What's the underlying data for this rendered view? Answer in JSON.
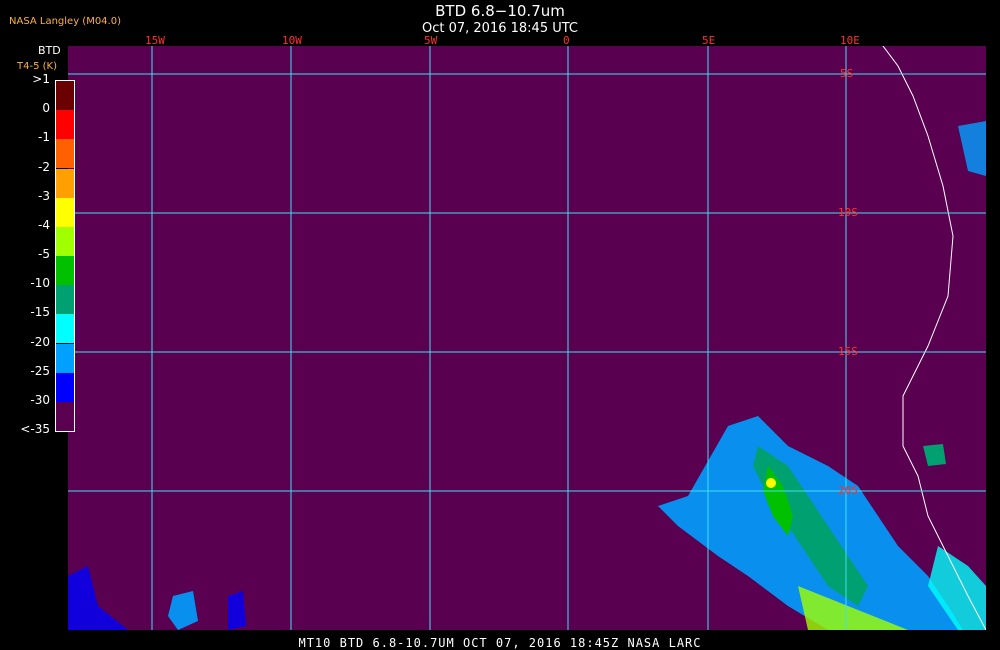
{
  "header": {
    "title": "BTD 6.8−10.7um",
    "subtitle": "Oct 07, 2016 18:45 UTC",
    "credit": "NASA Langley (M04.0)"
  },
  "legend": {
    "title": "BTD",
    "subtitle": "T4-5 (K)",
    "levels": [
      ">1",
      "0",
      "-1",
      "-2",
      "-3",
      "-4",
      "-5",
      "-10",
      "-15",
      "-20",
      "-25",
      "-30",
      "<-35"
    ],
    "colors": [
      "#6b0000",
      "#ff0000",
      "#ff6000",
      "#ffa000",
      "#ffff00",
      "#a0ff00",
      "#00c000",
      "#00a070",
      "#00ffff",
      "#00a0ff",
      "#0000ff",
      "#5a0050"
    ]
  },
  "map": {
    "background_color": "#5a0050",
    "grid_color": "#40e0f0",
    "coast_color": "#ffffff",
    "longitude_labels": [
      "15W",
      "10W",
      "5W",
      "0",
      "5E",
      "10E"
    ],
    "latitude_labels": [
      "5S",
      "10S",
      "15S",
      "20S"
    ]
  },
  "footer": {
    "text": "MT10   BTD 6.8-10.7UM   OCT 07, 2016 18:45Z   NASA LARC"
  }
}
